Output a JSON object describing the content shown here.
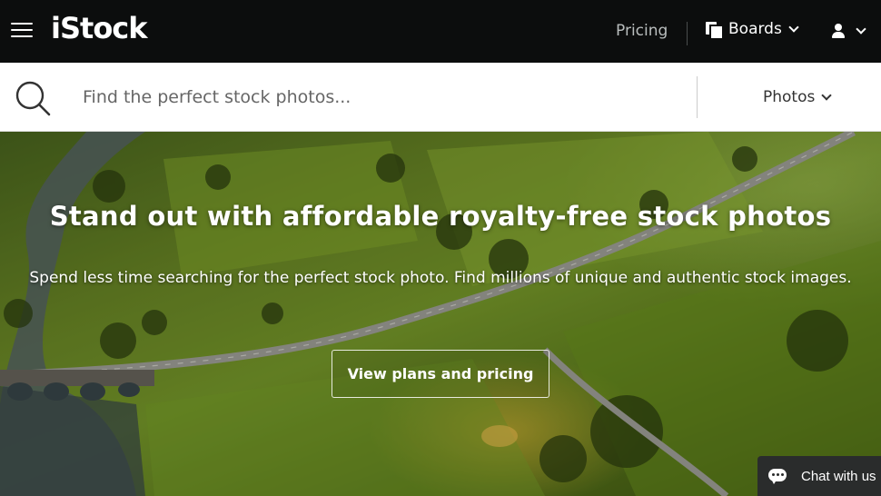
{
  "header": {
    "logo": "iStock",
    "pricing_label": "Pricing",
    "boards_label": "Boards"
  },
  "search": {
    "placeholder": "Find the perfect stock photos...",
    "type_selected": "Photos"
  },
  "hero": {
    "title": "Stand out with affordable royalty-free stock photos",
    "subtitle": "Spend less time searching for the perfect stock photo. Find millions of unique and authentic stock images.",
    "cta_label": "View plans and pricing"
  },
  "chat": {
    "label": "Chat with us"
  },
  "colors": {
    "nav_bg": "#0c0d0d",
    "chat_bg": "#2a2c2c"
  }
}
